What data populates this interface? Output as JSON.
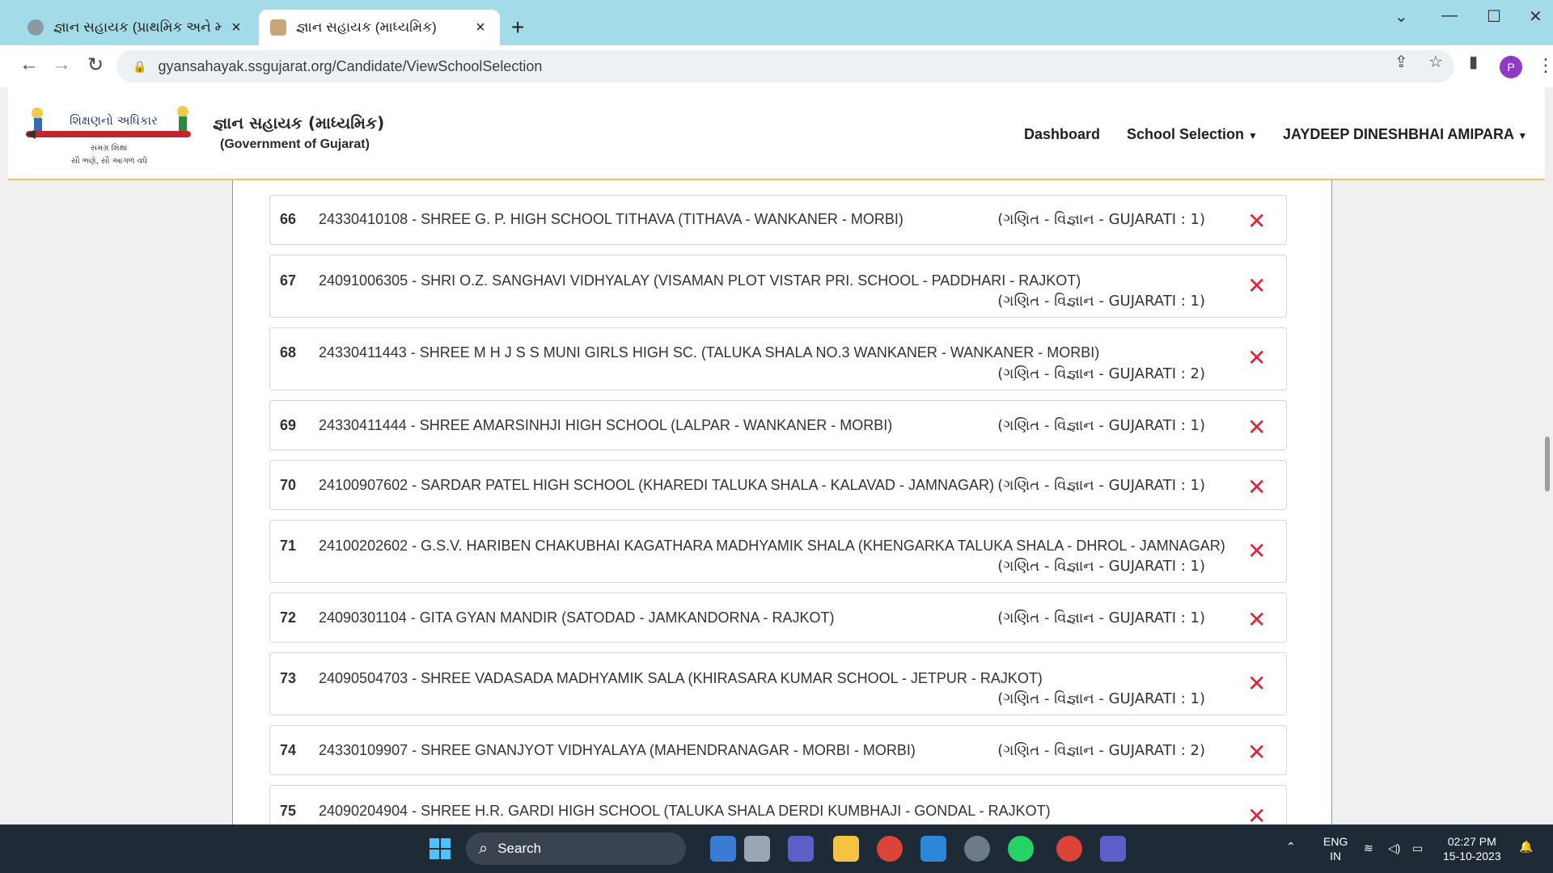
{
  "browser": {
    "tabs": [
      {
        "title": "જ્ઞાન સહાયક (પ્રાથમિક અને માધ્યમિ",
        "active": false
      },
      {
        "title": "જ્ઞાન સહાયક (માધ્યમિક)",
        "active": true
      }
    ],
    "url": "gyansahayak.ssgujarat.org/Candidate/ViewSchoolSelection",
    "profile_initial": "P"
  },
  "header": {
    "logo_text_main": "શિક્ષણનો અધિકાર",
    "logo_text_sub1": "સમગ્ર શિક્ષા",
    "logo_text_sub2": "સૌ ભણે, સૌ આગળ વધે",
    "title": "જ્ઞાન સહાયક (માધ્યમિક)",
    "subtitle": "(Government of Gujarat)",
    "nav": {
      "dashboard": "Dashboard",
      "school_selection": "School Selection",
      "user": "JAYDEEP DINESHBHAI AMIPARA"
    }
  },
  "rows": [
    {
      "num": "66",
      "school": "24330410108 - SHREE G. P. HIGH SCHOOL TITHAVA (TITHAVA - WANKANER - MORBI)",
      "subject": "(ગણિત - વિજ્ઞાન - GUJARATI : 1)"
    },
    {
      "num": "67",
      "school": "24091006305 - SHRI O.Z. SANGHAVI VIDHYALAY (VISAMAN PLOT VISTAR PRI. SCHOOL - PADDHARI - RAJKOT)",
      "subject": "(ગણિત - વિજ્ઞાન - GUJARATI : 1)"
    },
    {
      "num": "68",
      "school": "24330411443 - SHREE M H J S S MUNI GIRLS HIGH SC. (TALUKA SHALA NO.3 WANKANER - WANKANER - MORBI)",
      "subject": "(ગણિત - વિજ્ઞાન - GUJARATI : 2)"
    },
    {
      "num": "69",
      "school": "24330411444 - SHREE AMARSINHJI HIGH SCHOOL (LALPAR - WANKANER - MORBI)",
      "subject": "(ગણિત - વિજ્ઞાન - GUJARATI : 1)"
    },
    {
      "num": "70",
      "school": "24100907602 - SARDAR PATEL HIGH SCHOOL (KHAREDI TALUKA SHALA - KALAVAD - JAMNAGAR)",
      "subject": "(ગણિત - વિજ્ઞાન - GUJARATI : 1)"
    },
    {
      "num": "71",
      "school": "24100202602 - G.S.V. HARIBEN CHAKUBHAI KAGATHARA MADHYAMIK SHALA (KHENGARKA TALUKA SHALA - DHROL - JAMNAGAR)",
      "subject": "(ગણિત - વિજ્ઞાન - GUJARATI : 1)"
    },
    {
      "num": "72",
      "school": "24090301104 - GITA GYAN MANDIR (SATODAD - JAMKANDORNA - RAJKOT)",
      "subject": "(ગણિત - વિજ્ઞાન - GUJARATI : 1)"
    },
    {
      "num": "73",
      "school": "24090504703 - SHREE VADASADA MADHYAMIK SALA (KHIRASARA KUMAR SCHOOL - JETPUR - RAJKOT)",
      "subject": "(ગણિત - વિજ્ઞાન - GUJARATI : 1)"
    },
    {
      "num": "74",
      "school": "24330109907 - SHREE GNANJYOT VIDHYALAYA (MAHENDRANAGAR - MORBI - MORBI)",
      "subject": "(ગણિત - વિજ્ઞાન - GUJARATI : 2)"
    },
    {
      "num": "75",
      "school": "24090204904 - SHREE H.R. GARDI HIGH SCHOOL (TALUKA SHALA DERDI KUMBHAJI - GONDAL - RAJKOT)",
      "subject": ""
    }
  ],
  "remove_glyph": "✕",
  "taskbar": {
    "search_placeholder": "Search",
    "lang_line1": "ENG",
    "lang_line2": "IN",
    "time": "02:27 PM",
    "date": "15-10-2023"
  },
  "colors": {
    "tab_bar": "#a4dbe8",
    "remove_icon": "#e0253a",
    "header_border": "#f3c16a",
    "taskbar": "#1e2a36"
  }
}
